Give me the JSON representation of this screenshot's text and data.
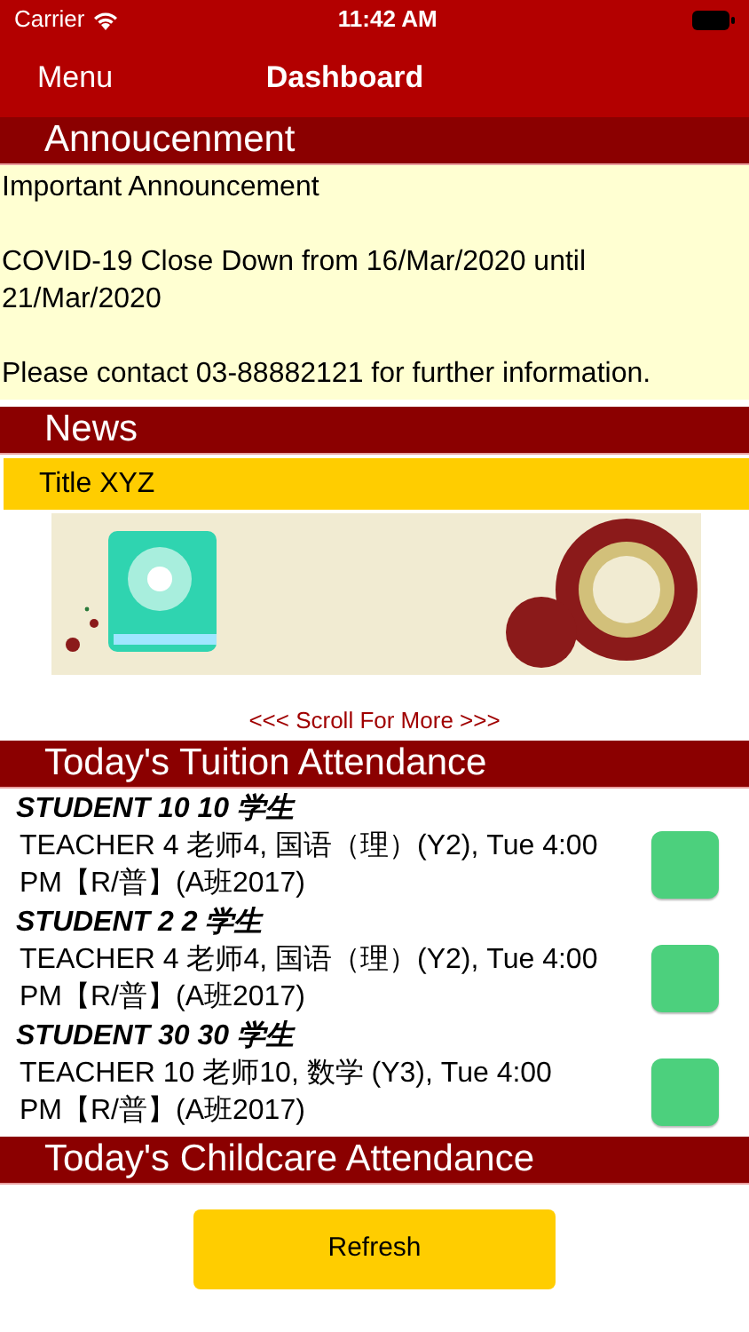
{
  "status_bar": {
    "carrier": "Carrier",
    "time": "11:42 AM"
  },
  "nav": {
    "left": "Menu",
    "title": "Dashboard"
  },
  "announcement": {
    "heading": "Annoucenment",
    "lines": [
      "Important Announcement",
      "COVID-19 Close Down from 16/Mar/2020 until 21/Mar/2020",
      "Please contact 03-88882121 for further information."
    ]
  },
  "news": {
    "heading": "News",
    "title": "Title XYZ",
    "scroll_hint": "<<<   Scroll For More   >>>"
  },
  "tuition": {
    "heading": "Today's Tuition Attendance",
    "students": [
      {
        "name": "STUDENT 10 10  学生",
        "detail": "TEACHER 4 老师4, 国语（理）(Y2), Tue 4:00 PM【R/普】(A班2017)",
        "color": "#4cd07d"
      },
      {
        "name": "STUDENT 2 2  学生",
        "detail": "TEACHER 4 老师4, 国语（理）(Y2), Tue 4:00 PM【R/普】(A班2017)",
        "color": "#4cd07d"
      },
      {
        "name": "STUDENT 30 30  学生",
        "detail": "TEACHER 10 老师10, 数学 (Y3), Tue 4:00 PM【R/普】(A班2017)",
        "color": "#4cd07d"
      }
    ]
  },
  "childcare": {
    "heading": "Today's Childcare Attendance"
  },
  "refresh_button": "Refresh"
}
